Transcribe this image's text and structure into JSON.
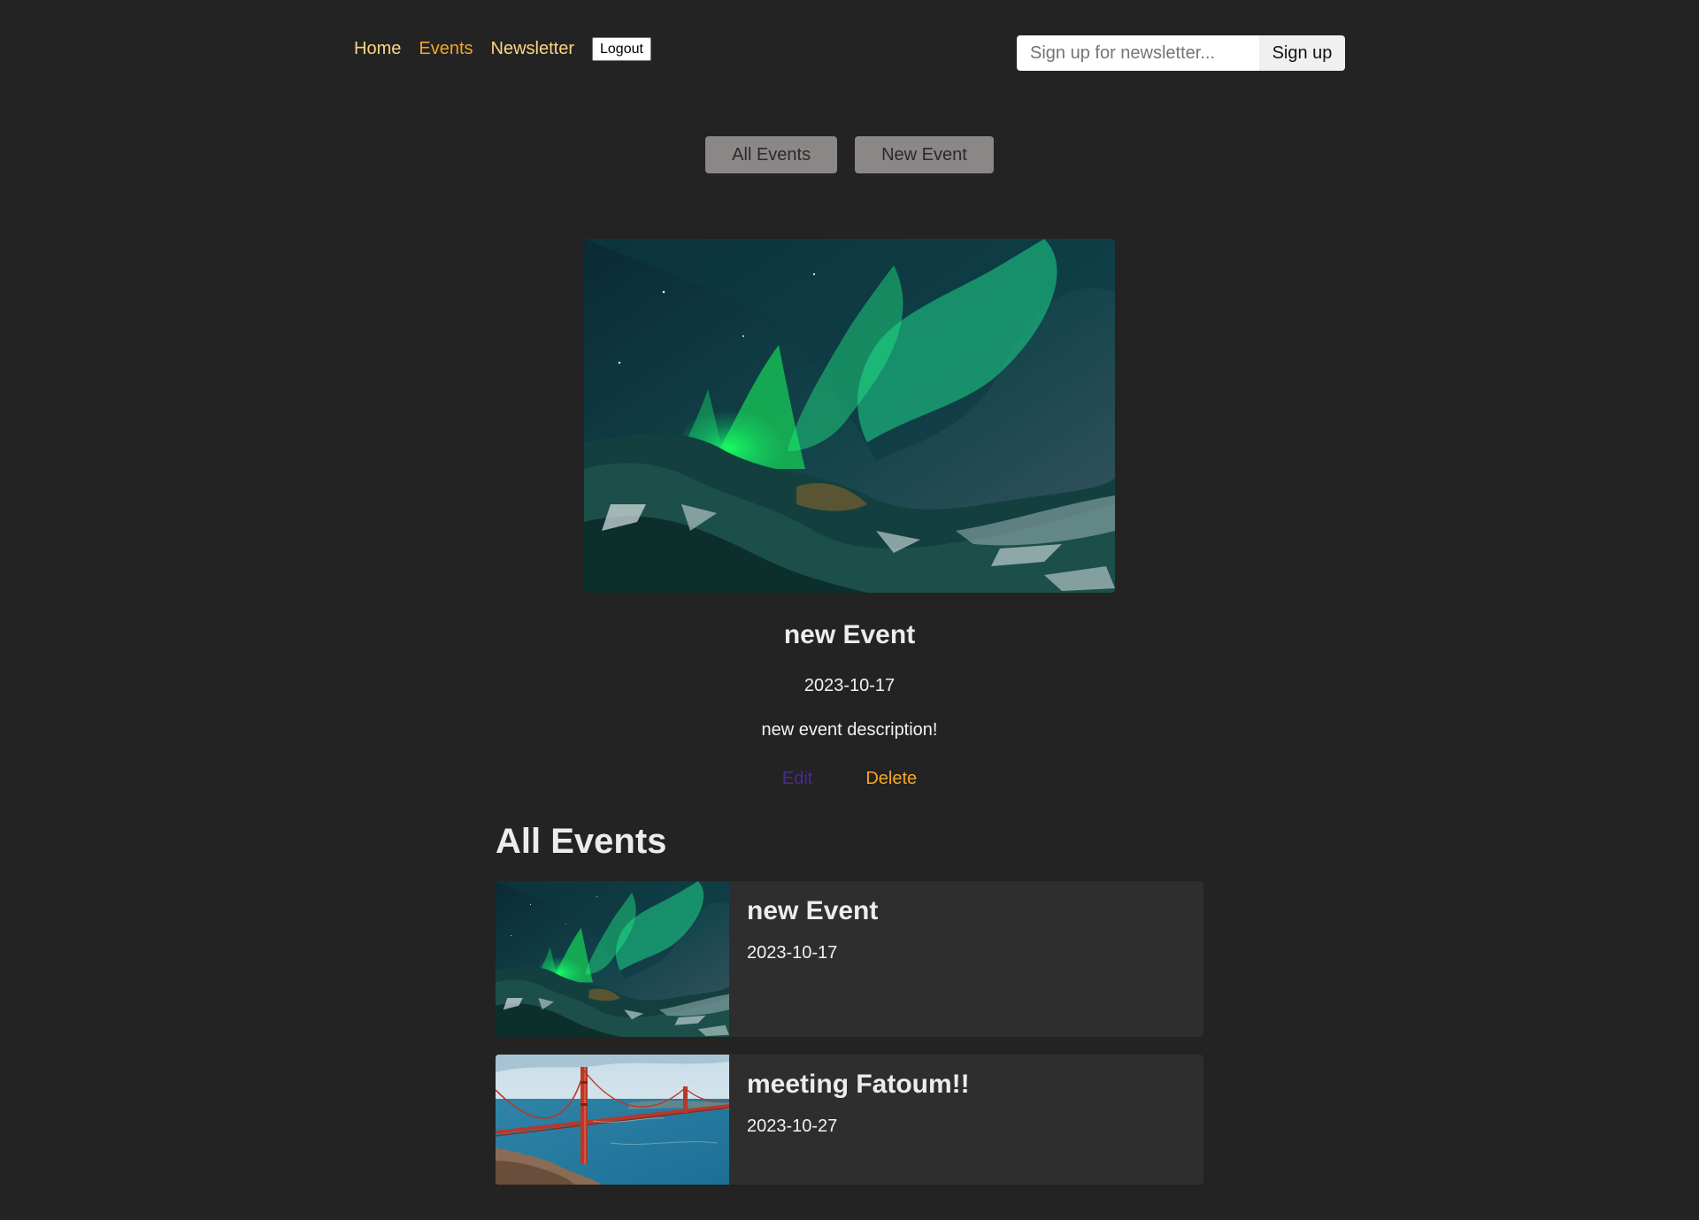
{
  "header": {
    "nav": {
      "home": "Home",
      "events": "Events",
      "newsletter": "Newsletter",
      "logout": "Logout"
    },
    "newsletter_form": {
      "placeholder": "Sign up for newsletter...",
      "submit": "Sign up"
    }
  },
  "events_nav": {
    "all_events": "All Events",
    "new_event": "New Event"
  },
  "event_detail": {
    "image_alt": "new Event",
    "title": "new Event",
    "date": "2023-10-17",
    "description": "new event description!",
    "edit_label": "Edit",
    "delete_label": "Delete"
  },
  "events_list": {
    "title": "All Events",
    "items": [
      {
        "title": "new Event",
        "date": "2023-10-17",
        "image": "aurora"
      },
      {
        "title": "meeting Fatoum!!",
        "date": "2023-10-27",
        "image": "golden-gate-bridge"
      }
    ]
  },
  "colors": {
    "background": "#232323",
    "nav_link": "#fcd581",
    "nav_link_active": "#f5a623",
    "button_bg": "#8a8786",
    "card_bg": "#2f2e2e",
    "edit_link": "#4c2a8c",
    "delete": "#f5a623"
  }
}
